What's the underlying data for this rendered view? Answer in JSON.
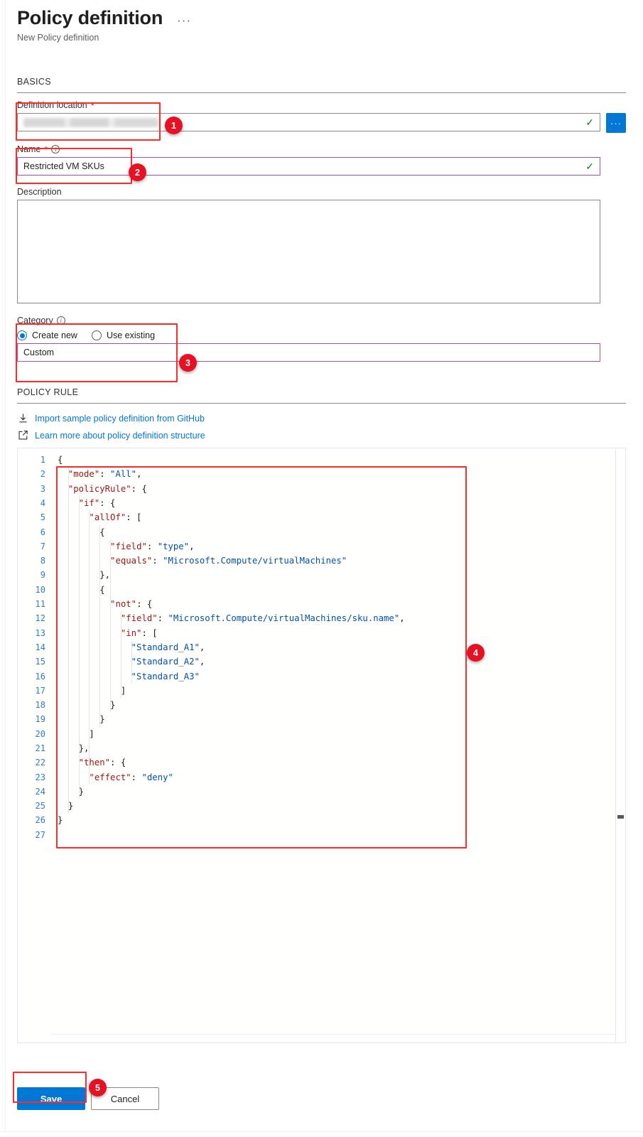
{
  "header": {
    "title": "Policy definition",
    "subtitle": "New Policy definition",
    "more_menu": "···"
  },
  "sections": {
    "basics_label": "BASICS",
    "policy_rule_label": "POLICY RULE"
  },
  "fields": {
    "definition_location": {
      "label": "Definition location",
      "required_mark": "*",
      "value": "",
      "redacted": true,
      "valid_icon": "✓",
      "picker_button": "···"
    },
    "name": {
      "label": "Name",
      "required_mark": "*",
      "info_icon": "i",
      "value": "Restricted VM SKUs",
      "valid_icon": "✓"
    },
    "description": {
      "label": "Description",
      "value": ""
    },
    "category": {
      "label": "Category",
      "info_icon": "i",
      "options": [
        {
          "label": "Create new",
          "selected": true
        },
        {
          "label": "Use existing",
          "selected": false
        }
      ],
      "value": "Custom"
    }
  },
  "links": [
    {
      "label": "Import sample policy definition from GitHub",
      "icon": "download-icon"
    },
    {
      "label": "Learn more about policy definition structure",
      "icon": "external-link-icon"
    }
  ],
  "editor": {
    "total_lines": 27,
    "lines": [
      {
        "n": 1,
        "indent": 0,
        "tokens": [
          {
            "t": "p",
            "v": "{"
          }
        ]
      },
      {
        "n": 2,
        "indent": 1,
        "tokens": [
          {
            "t": "k",
            "v": "\"mode\""
          },
          {
            "t": "p",
            "v": ": "
          },
          {
            "t": "s",
            "v": "\"All\""
          },
          {
            "t": "p",
            "v": ","
          }
        ]
      },
      {
        "n": 3,
        "indent": 1,
        "tokens": [
          {
            "t": "k",
            "v": "\"policyRule\""
          },
          {
            "t": "p",
            "v": ": {"
          }
        ]
      },
      {
        "n": 4,
        "indent": 2,
        "tokens": [
          {
            "t": "k",
            "v": "\"if\""
          },
          {
            "t": "p",
            "v": ": {"
          }
        ]
      },
      {
        "n": 5,
        "indent": 3,
        "tokens": [
          {
            "t": "k",
            "v": "\"allOf\""
          },
          {
            "t": "p",
            "v": ": ["
          }
        ]
      },
      {
        "n": 6,
        "indent": 4,
        "tokens": [
          {
            "t": "p",
            "v": "{"
          }
        ]
      },
      {
        "n": 7,
        "indent": 5,
        "tokens": [
          {
            "t": "k",
            "v": "\"field\""
          },
          {
            "t": "p",
            "v": ": "
          },
          {
            "t": "s",
            "v": "\"type\""
          },
          {
            "t": "p",
            "v": ","
          }
        ]
      },
      {
        "n": 8,
        "indent": 5,
        "tokens": [
          {
            "t": "k",
            "v": "\"equals\""
          },
          {
            "t": "p",
            "v": ": "
          },
          {
            "t": "s",
            "v": "\"Microsoft.Compute/virtualMachines\""
          }
        ]
      },
      {
        "n": 9,
        "indent": 4,
        "tokens": [
          {
            "t": "p",
            "v": "},"
          }
        ]
      },
      {
        "n": 10,
        "indent": 4,
        "tokens": [
          {
            "t": "p",
            "v": "{"
          }
        ]
      },
      {
        "n": 11,
        "indent": 5,
        "tokens": [
          {
            "t": "k",
            "v": "\"not\""
          },
          {
            "t": "p",
            "v": ": {"
          }
        ]
      },
      {
        "n": 12,
        "indent": 6,
        "tokens": [
          {
            "t": "k",
            "v": "\"field\""
          },
          {
            "t": "p",
            "v": ": "
          },
          {
            "t": "s",
            "v": "\"Microsoft.Compute/virtualMachines/sku.name\""
          },
          {
            "t": "p",
            "v": ","
          }
        ]
      },
      {
        "n": 13,
        "indent": 6,
        "tokens": [
          {
            "t": "k",
            "v": "\"in\""
          },
          {
            "t": "p",
            "v": ": ["
          }
        ]
      },
      {
        "n": 14,
        "indent": 7,
        "tokens": [
          {
            "t": "s",
            "v": "\"Standard_A1\""
          },
          {
            "t": "p",
            "v": ","
          }
        ]
      },
      {
        "n": 15,
        "indent": 7,
        "tokens": [
          {
            "t": "s",
            "v": "\"Standard_A2\""
          },
          {
            "t": "p",
            "v": ","
          }
        ]
      },
      {
        "n": 16,
        "indent": 7,
        "tokens": [
          {
            "t": "s",
            "v": "\"Standard_A3\""
          }
        ]
      },
      {
        "n": 17,
        "indent": 6,
        "tokens": [
          {
            "t": "p",
            "v": "]"
          }
        ]
      },
      {
        "n": 18,
        "indent": 5,
        "tokens": [
          {
            "t": "p",
            "v": "}"
          }
        ]
      },
      {
        "n": 19,
        "indent": 4,
        "tokens": [
          {
            "t": "p",
            "v": "}"
          }
        ]
      },
      {
        "n": 20,
        "indent": 3,
        "tokens": [
          {
            "t": "p",
            "v": "]"
          }
        ]
      },
      {
        "n": 21,
        "indent": 2,
        "tokens": [
          {
            "t": "p",
            "v": "},"
          }
        ]
      },
      {
        "n": 22,
        "indent": 2,
        "tokens": [
          {
            "t": "k",
            "v": "\"then\""
          },
          {
            "t": "p",
            "v": ": {"
          }
        ]
      },
      {
        "n": 23,
        "indent": 3,
        "tokens": [
          {
            "t": "k",
            "v": "\"effect\""
          },
          {
            "t": "p",
            "v": ": "
          },
          {
            "t": "s",
            "v": "\"deny\""
          }
        ]
      },
      {
        "n": 24,
        "indent": 2,
        "tokens": [
          {
            "t": "p",
            "v": "}"
          }
        ]
      },
      {
        "n": 25,
        "indent": 1,
        "tokens": [
          {
            "t": "p",
            "v": "}"
          }
        ]
      },
      {
        "n": 26,
        "indent": 0,
        "tokens": [
          {
            "t": "p",
            "v": "}"
          }
        ]
      },
      {
        "n": 27,
        "indent": 0,
        "tokens": []
      }
    ]
  },
  "footer": {
    "save_label": "Save",
    "cancel_label": "Cancel"
  },
  "annotations": [
    {
      "number": "1",
      "target": "definition-location-field"
    },
    {
      "number": "2",
      "target": "name-field"
    },
    {
      "number": "3",
      "target": "category-field"
    },
    {
      "number": "4",
      "target": "policy-rule-editor"
    },
    {
      "number": "5",
      "target": "save-button"
    }
  ],
  "colors": {
    "accent": "#0078d4",
    "annotation": "#e81123",
    "annotation_border": "#ff2b2b",
    "valid": "#107c10",
    "validated_border": "#a44fb7",
    "json_key": "#a31515",
    "json_string": "#0451a5",
    "line_number": "#2b7cd3"
  }
}
